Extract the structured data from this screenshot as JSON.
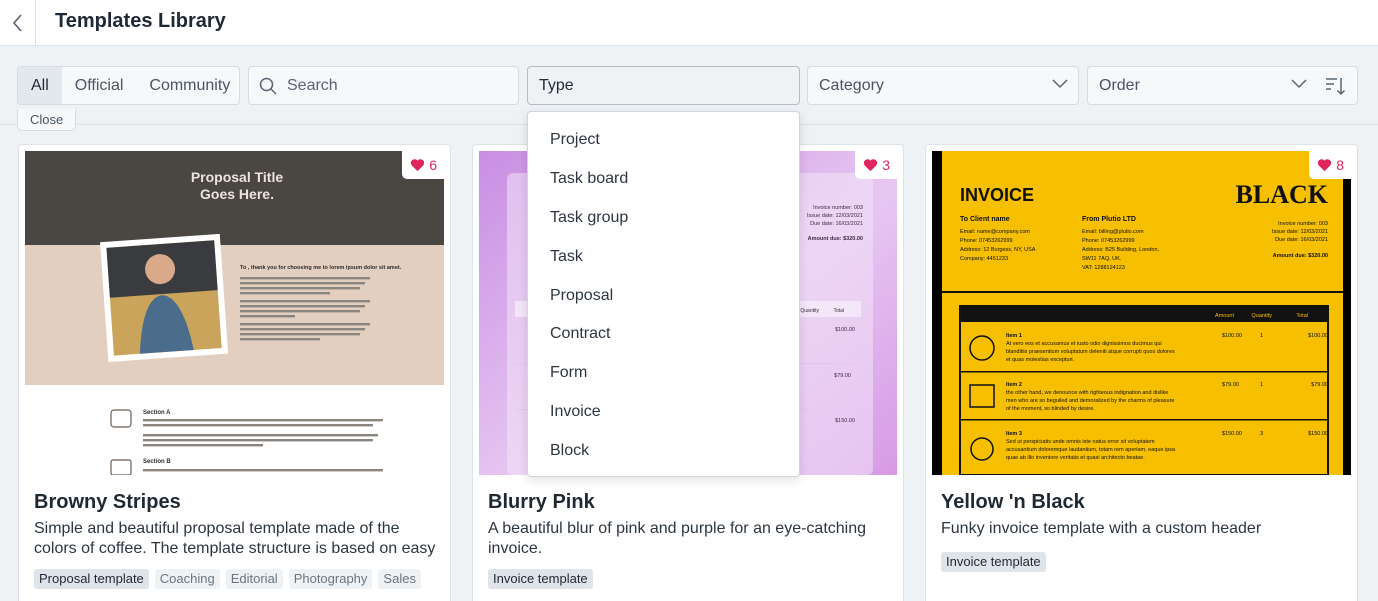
{
  "header": {
    "title": "Templates Library"
  },
  "filters": {
    "tabs": [
      {
        "label": "All"
      },
      {
        "label": "Official"
      },
      {
        "label": "Community"
      }
    ],
    "search_placeholder": "Search",
    "type_label": "Type",
    "category_label": "Category",
    "order_label": "Order",
    "close_label": "Close"
  },
  "type_options": [
    "Project",
    "Task board",
    "Task group",
    "Task",
    "Proposal",
    "Contract",
    "Form",
    "Invoice",
    "Block"
  ],
  "cards": [
    {
      "title": "Browny Stripes",
      "description": "Simple and beautiful proposal template made of the colors of coffee. The template structure is based on easy to",
      "likes": "6",
      "tags": [
        "Proposal template",
        "Coaching",
        "Editorial",
        "Photography",
        "Sales"
      ],
      "preview": {
        "heading_line1": "Proposal Title",
        "heading_line2": "Goes Here.",
        "intro": "To , thank you for choosing me to lorem ipsum dolor sit amet.",
        "section_a": "Section A",
        "section_b": "Section B"
      }
    },
    {
      "title": "Blurry Pink",
      "description": "A beautiful blur of pink and purple for an eye-catching invoice.",
      "likes": "3",
      "tags": [
        "Invoice template"
      ],
      "preview": {
        "invoice_number": "Invoice number: 003",
        "issue_date": "Issue date: 12/03/2021",
        "due_date": "Due date: 16/03/2021",
        "amount_due": "Amount due: $320.00",
        "col_quantity": "Quantity",
        "col_total": "Total",
        "v1": "$100.00",
        "v2": "$79.00",
        "v3": "$150.00"
      }
    },
    {
      "title": "Yellow 'n Black",
      "description": "Funky invoice template with a custom header",
      "likes": "8",
      "tags": [
        "Invoice template"
      ],
      "preview": {
        "heading": "INVOICE",
        "brand": "BLACK",
        "to_label": "To Client name",
        "from_label": "From Plutio LTD",
        "to_email": "Email: name@company.com",
        "to_phone": "Phone: 07453262999",
        "to_address": "Address: 12 Burgess, NY, USA",
        "to_company": "Company: 4451233",
        "from_email": "Email: billing@plutio.com",
        "from_phone": "Phone: 07453262999",
        "from_address": "Address: B25 Building, London,",
        "from_address2": "SW11 7AQ, UK.",
        "from_vat": "VAT: 1288124123",
        "invoice_number": "Invoice number: 003",
        "issue_date": "Issue date: 12/03/2021",
        "due_date": "Due date: 16/03/2021",
        "amount_due": "Amount due: $320.00",
        "col_amount": "Amount",
        "col_quantity": "Quantity",
        "col_total": "Total",
        "items": [
          {
            "name": "Item 1",
            "desc1": "At vero eos et accusamus et iusto odio dignissimos ducimus qui",
            "desc2": "blanditiis praesentium voluptatum deleniti atque corrupti quos dolores",
            "desc3": "et quas molestias excepturi.",
            "amount": "$100.00",
            "qty": "1",
            "total": "$100.00"
          },
          {
            "name": "Item 2",
            "desc1": "the other hand, we denounce with righteous indignation and dislike",
            "desc2": "men who are so beguiled and demoralized by the charms of pleasure",
            "desc3": "of the moment, so blinded by desire.",
            "amount": "$79.00",
            "qty": "1",
            "total": "$79.00"
          },
          {
            "name": "Item 3",
            "desc1": "Sed ut perspiciatis unde omnis iste natus error sit voluptatem",
            "desc2": "accusantium doloremque laudantium, totam rem aperiam, eaque ipsa",
            "desc3": "quae ab illo inventore veritatis et quasi architecto beatae.",
            "amount": "$150.00",
            "qty": "3",
            "total": "$150.00"
          }
        ]
      }
    }
  ]
}
